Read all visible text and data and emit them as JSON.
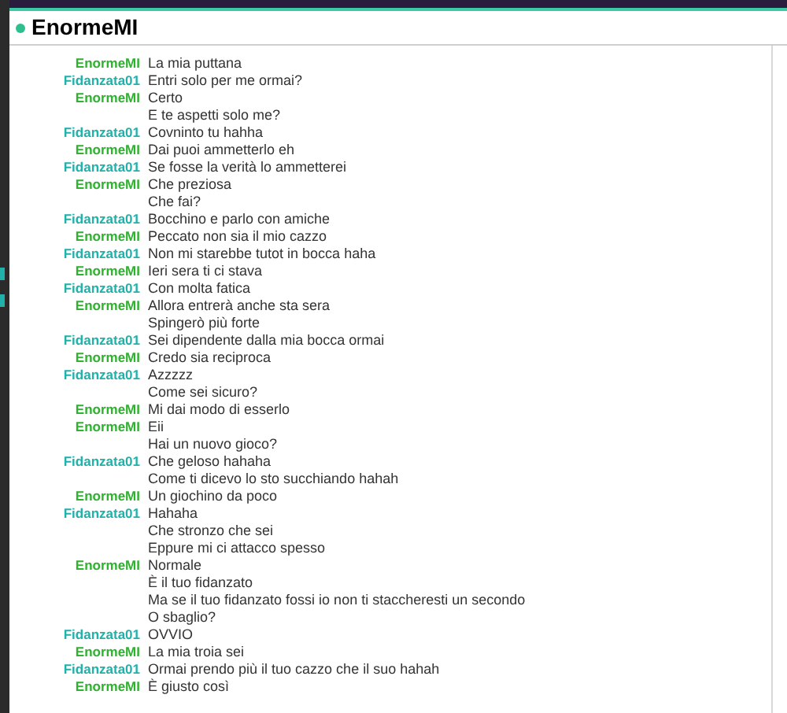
{
  "chat": {
    "title": "EnormeMI",
    "online": true
  },
  "messages": [
    {
      "sender": "EnormeMI",
      "color": "#2db32d",
      "text": "La mia puttana"
    },
    {
      "sender": "Fidanzata01",
      "color": "#20b2aa",
      "text": "Entri solo per me ormai?"
    },
    {
      "sender": "EnormeMI",
      "color": "#2db32d",
      "text": "Certo"
    },
    {
      "text": "E te aspetti solo me?"
    },
    {
      "sender": "Fidanzata01",
      "color": "#20b2aa",
      "text": "Covninto tu hahha"
    },
    {
      "sender": "EnormeMI",
      "color": "#2db32d",
      "text": "Dai puoi ammetterlo eh"
    },
    {
      "sender": "Fidanzata01",
      "color": "#20b2aa",
      "text": "Se fosse la verità lo ammetterei"
    },
    {
      "sender": "EnormeMI",
      "color": "#2db32d",
      "text": "Che preziosa"
    },
    {
      "text": "Che fai?"
    },
    {
      "sender": "Fidanzata01",
      "color": "#20b2aa",
      "text": "Bocchino e parlo con amiche"
    },
    {
      "sender": "EnormeMI",
      "color": "#2db32d",
      "text": "Peccato non sia il mio cazzo"
    },
    {
      "sender": "Fidanzata01",
      "color": "#20b2aa",
      "text": "Non mi starebbe tutot in bocca haha"
    },
    {
      "sender": "EnormeMI",
      "color": "#2db32d",
      "text": "Ieri sera ti ci stava"
    },
    {
      "sender": "Fidanzata01",
      "color": "#20b2aa",
      "text": "Con molta fatica"
    },
    {
      "sender": "EnormeMI",
      "color": "#2db32d",
      "text": "Allora entrerà anche sta sera"
    },
    {
      "text": "Spingerò più forte"
    },
    {
      "sender": "Fidanzata01",
      "color": "#20b2aa",
      "text": "Sei dipendente dalla mia bocca ormai"
    },
    {
      "sender": "EnormeMI",
      "color": "#2db32d",
      "text": "Credo sia reciproca"
    },
    {
      "sender": "Fidanzata01",
      "color": "#20b2aa",
      "text": "Azzzzz"
    },
    {
      "text": "Come sei sicuro?"
    },
    {
      "sender": "EnormeMI",
      "color": "#2db32d",
      "text": "Mi dai modo di esserlo"
    },
    {
      "sender": "EnormeMI",
      "color": "#2db32d",
      "text": "Eii"
    },
    {
      "text": "Hai un nuovo gioco?"
    },
    {
      "sender": "Fidanzata01",
      "color": "#20b2aa",
      "text": "Che geloso hahaha"
    },
    {
      "text": "Come ti dicevo lo sto succhiando hahah"
    },
    {
      "sender": "EnormeMI",
      "color": "#2db32d",
      "text": "Un giochino da poco"
    },
    {
      "sender": "Fidanzata01",
      "color": "#20b2aa",
      "text": "Hahaha"
    },
    {
      "text": "Che stronzo che sei"
    },
    {
      "text": "Eppure mi ci attacco spesso"
    },
    {
      "sender": "EnormeMI",
      "color": "#2db32d",
      "text": "Normale"
    },
    {
      "text": "È il tuo fidanzato"
    },
    {
      "text": "Ma se il tuo fidanzato fossi io non ti staccheresti un secondo"
    },
    {
      "text": "O sbaglio?"
    },
    {
      "sender": "Fidanzata01",
      "color": "#20b2aa",
      "text": "OVVIO"
    },
    {
      "sender": "EnormeMI",
      "color": "#2db32d",
      "text": "La mia troia sei"
    },
    {
      "sender": "Fidanzata01",
      "color": "#20b2aa",
      "text": "Ormai prendo più il tuo cazzo che il suo hahah"
    },
    {
      "sender": "EnormeMI",
      "color": "#2db32d",
      "text": "È giusto così"
    }
  ]
}
